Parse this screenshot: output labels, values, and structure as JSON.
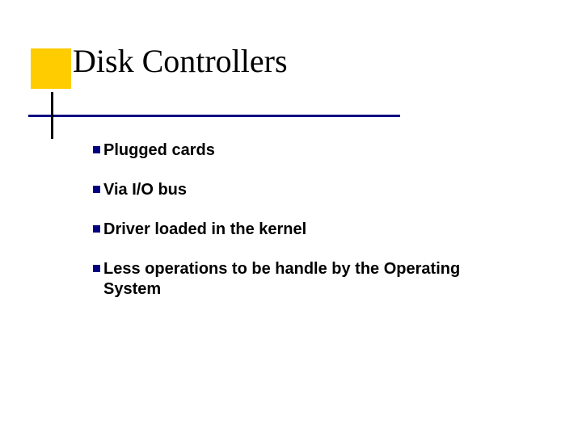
{
  "colors": {
    "accent_square": "#ffcc00",
    "rule": "#000080",
    "bullet": "#000080"
  },
  "slide": {
    "title": "Disk Controllers",
    "bullets": [
      {
        "text": "Plugged cards"
      },
      {
        "text": "Via I/O bus"
      },
      {
        "text": "Driver loaded in the kernel"
      },
      {
        "text": "Less operations to be handle by the Operating System"
      }
    ]
  }
}
